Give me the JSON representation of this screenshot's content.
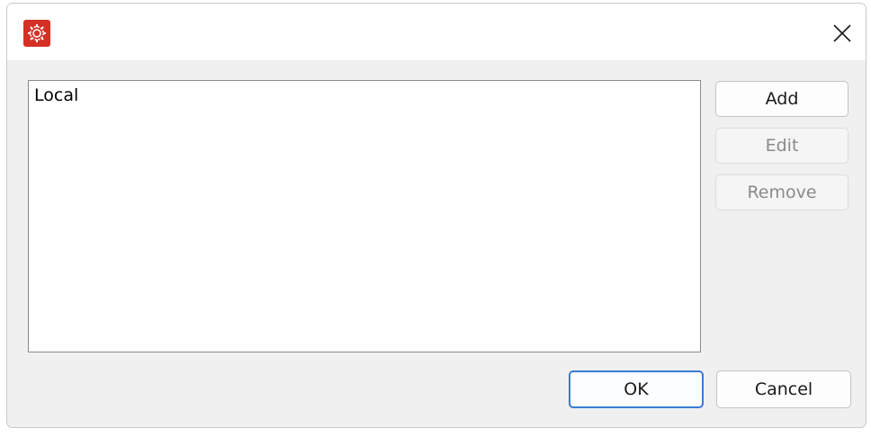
{
  "window": {
    "title": "",
    "app_icon": "gear-icon",
    "close_icon": "close-icon"
  },
  "list": {
    "items": [
      "Local"
    ]
  },
  "side_buttons": {
    "add": "Add",
    "edit": "Edit",
    "remove": "Remove"
  },
  "footer_buttons": {
    "ok": "OK",
    "cancel": "Cancel"
  },
  "colors": {
    "app_icon_bg": "#d43025",
    "default_button_border": "#3a7bd5",
    "disabled_text": "#8a8a8a"
  }
}
